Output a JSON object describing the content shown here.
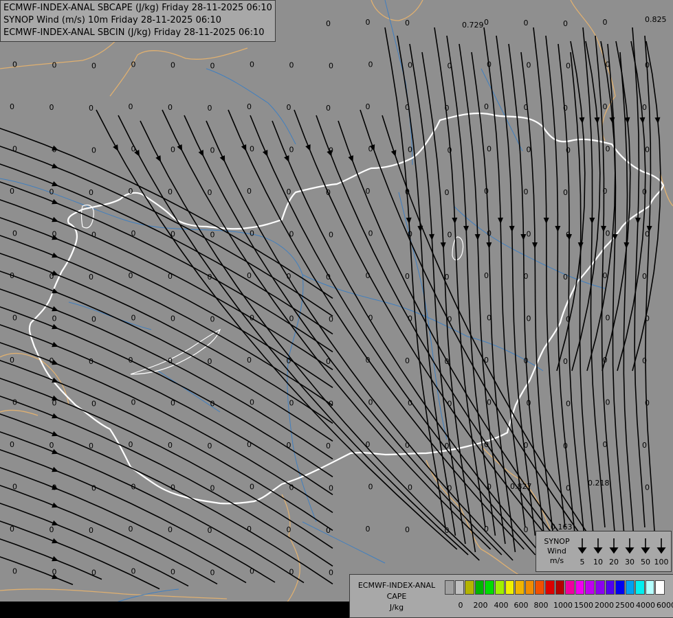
{
  "header": {
    "lines": [
      "ECMWF-INDEX-ANAL SBCAPE (J/kg) Friday 28-11-2025 06:10",
      "SYNOP Wind (m/s) 10m Friday 28-11-2025 06:10",
      "ECMWF-INDEX-ANAL SBCIN (J/kg) Friday 28-11-2025 06:10"
    ]
  },
  "map": {
    "background_color": "#8f8f8f",
    "border_colors": {
      "hungary": "#ffffff",
      "neighbors": "#e0b070",
      "rivers": "#3f7fc0"
    },
    "point_values": {
      "zero": "0",
      "nonzero": [
        "0.825",
        "0.729",
        "0.827",
        "0.218",
        "0.163",
        "0.0551"
      ]
    }
  },
  "wind_legend": {
    "title_lines": [
      "SYNOP",
      "Wind",
      "m/s"
    ],
    "speeds": [
      "5",
      "10",
      "20",
      "30",
      "50",
      "100"
    ]
  },
  "cape_legend": {
    "title_lines": [
      "ECMWF-INDEX-ANAL",
      "CAPE",
      "J/kg"
    ],
    "colors": [
      "#a0a0a0",
      "#c0c0c0",
      "#b4b400",
      "#00b400",
      "#00dc00",
      "#a0f000",
      "#f0f000",
      "#f0b400",
      "#f08c00",
      "#f05000",
      "#dc0000",
      "#b40000",
      "#f000a0",
      "#f000f0",
      "#c000f0",
      "#8c00f0",
      "#5000f0",
      "#0000f0",
      "#00a0f0",
      "#00f0f0",
      "#b4ffff",
      "#ffffff"
    ],
    "ticks": [
      "0",
      "200",
      "400",
      "600",
      "800",
      "1000",
      "1500",
      "2000",
      "2500",
      "4000",
      "6000"
    ]
  }
}
